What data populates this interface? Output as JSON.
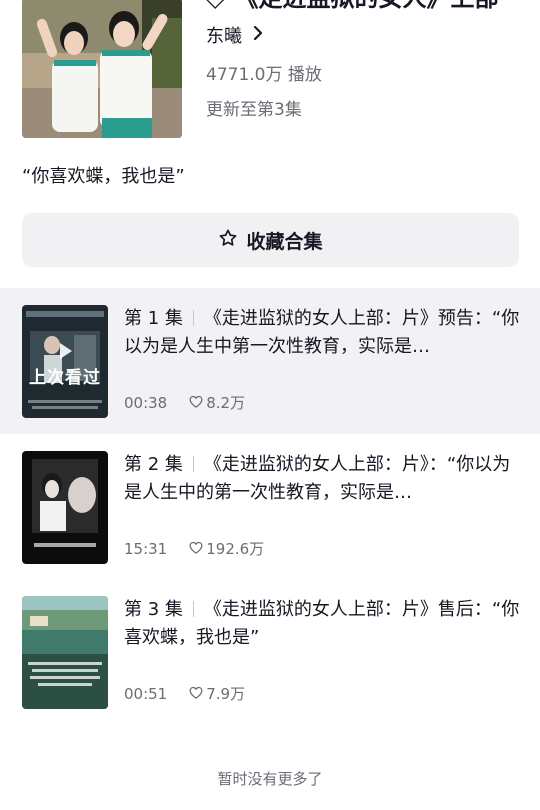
{
  "header": {
    "title": "《走进监狱的女人》上部",
    "author": "东曦",
    "plays": "4771.0万 播放",
    "update": "更新至第3集"
  },
  "description": "“你喜欢蝶，我也是”",
  "collect_button": {
    "label": "收藏合集",
    "icon": "star-outline-icon"
  },
  "episodes": [
    {
      "ep": "第 1 集",
      "title": "《走进监狱的女人上部：片》预告：“你以为是人生中第一次性教育，实际是…",
      "duration": "00:38",
      "likes": "8.2万",
      "badge": "上次看过",
      "active": true
    },
    {
      "ep": "第 2 集",
      "title": "《走进监狱的女人上部：片》：“你以为是人生中的第一次性教育，实际是…",
      "duration": "15:31",
      "likes": "192.6万",
      "active": false
    },
    {
      "ep": "第 3 集",
      "title": "《走进监狱的女人上部：片》售后：“你喜欢蝶，我也是”",
      "duration": "00:51",
      "likes": "7.9万",
      "active": false
    }
  ],
  "footer": "暂时没有更多了",
  "colors": {
    "active_row": "#f2f2f4",
    "secondary_text": "#6b6d75",
    "button_bg": "#f1f1f3"
  }
}
